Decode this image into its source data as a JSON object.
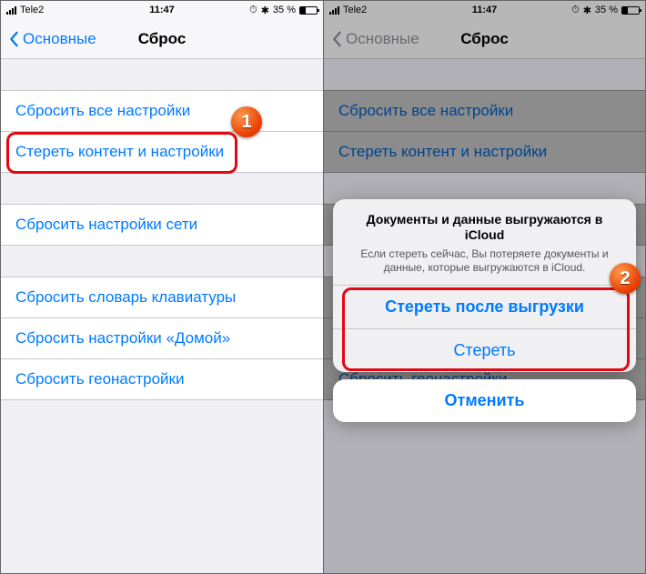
{
  "status": {
    "carrier": "Tele2",
    "time": "11:47",
    "battery_text": "35 %",
    "alarm_glyph": "⏱",
    "bt_glyph": "✱"
  },
  "nav": {
    "back_label": "Основные",
    "title": "Сброс"
  },
  "rows": {
    "reset_all": "Сбросить все настройки",
    "erase_content": "Стереть контент и настройки",
    "reset_network": "Сбросить настройки сети",
    "reset_keyboard": "Сбросить словарь клавиатуры",
    "reset_home": "Сбросить настройки «Домой»",
    "reset_location": "Сбросить геонастройки"
  },
  "alert": {
    "title": "Документы и данные выгружаются в iCloud",
    "message": "Если стереть сейчас, Вы потеряете документы и данные, которые выгружаются в iCloud.",
    "btn_after": "Стереть после выгрузки",
    "btn_erase": "Стереть",
    "btn_cancel": "Отменить"
  },
  "markers": {
    "step1": "1",
    "step2": "2"
  }
}
